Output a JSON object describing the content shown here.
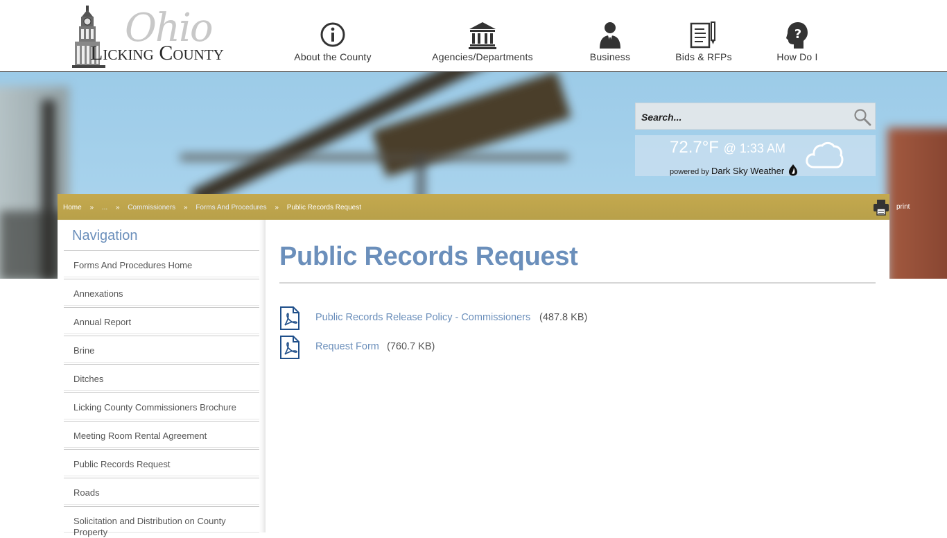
{
  "header": {
    "logo": {
      "script_word": "Ohio",
      "name": "Licking County"
    },
    "nav": [
      {
        "label": "About the County",
        "icon": "info-icon"
      },
      {
        "label": "Agencies/Departments",
        "icon": "courthouse-icon"
      },
      {
        "label": "Business",
        "icon": "businessman-icon"
      },
      {
        "label": "Bids & RFPs",
        "icon": "document-pen-icon"
      },
      {
        "label": "How Do I",
        "icon": "question-head-icon"
      }
    ]
  },
  "search": {
    "placeholder": "Search..."
  },
  "weather": {
    "temperature": "72.7°F",
    "time": "@ 1:33 AM",
    "powered_prefix": "powered by",
    "provider": "Dark Sky Weather",
    "condition_icon": "cloud-icon"
  },
  "breadcrumb": {
    "home": "Home",
    "ellipsis": "...",
    "level1": "Commissioners",
    "level2": "Forms And Procedures",
    "current": "Public Records Request",
    "separator": "»"
  },
  "print_label": "print",
  "sidebar": {
    "heading": "Navigation",
    "items": [
      "Forms And Procedures Home",
      "Annexations",
      "Annual Report",
      "Brine",
      "Ditches",
      "Licking County Commissioners Brochure",
      "Meeting Room Rental Agreement",
      "Public Records Request",
      "Roads",
      "Solicitation and Distribution on County Property"
    ]
  },
  "main": {
    "title": "Public Records Request",
    "documents": [
      {
        "name": "Public Records Release Policy - Commissioners",
        "size": "(487.8 KB)",
        "icon": "pdf-icon"
      },
      {
        "name": "Request Form",
        "size": "(760.7 KB)",
        "icon": "pdf-icon"
      }
    ]
  },
  "colors": {
    "accent_blue": "#6b8fbb",
    "breadcrumb_gold": "#c4a94e",
    "header_border": "#222222"
  }
}
